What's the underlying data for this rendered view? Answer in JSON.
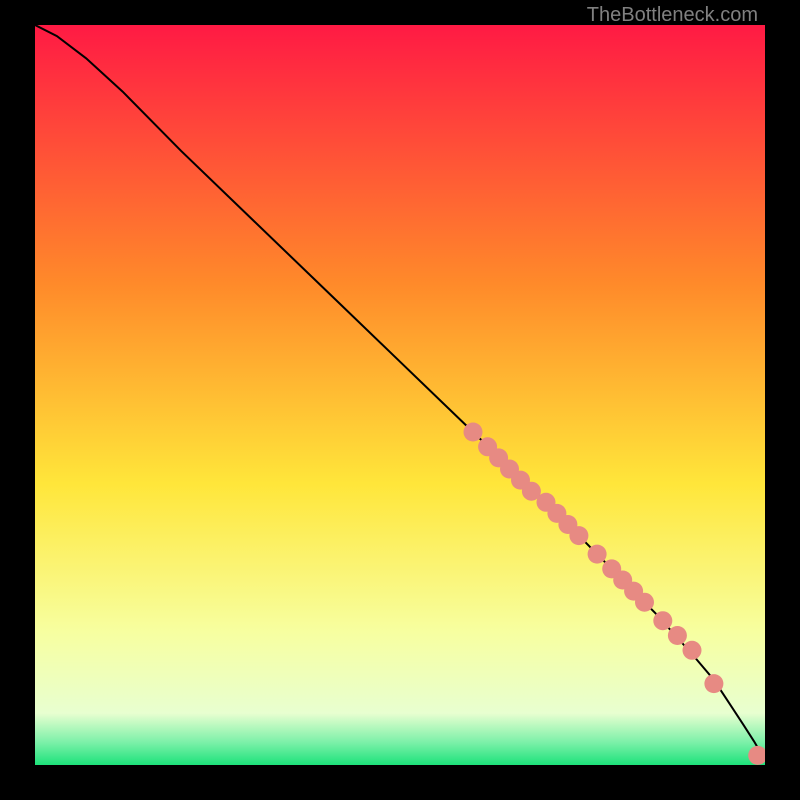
{
  "attribution": "TheBottleneck.com",
  "colors": {
    "frame": "#000000",
    "grad_top": "#ff1a44",
    "grad_mid1": "#ff8a2a",
    "grad_mid2": "#ffe63a",
    "grad_mid3": "#f7ffa0",
    "grad_bottom": "#1de27a",
    "curve": "#000000",
    "markers": "#e78a83"
  },
  "chart_data": {
    "type": "line",
    "title": "",
    "xlabel": "",
    "ylabel": "",
    "xlim": [
      0,
      100
    ],
    "ylim": [
      0,
      100
    ],
    "curve": {
      "x": [
        0,
        3,
        7,
        12,
        20,
        30,
        40,
        50,
        60,
        70,
        80,
        85,
        90,
        93,
        95,
        97,
        98.5,
        99.5,
        100
      ],
      "y": [
        100,
        98.5,
        95.5,
        91,
        83,
        73.5,
        64,
        54.5,
        45,
        35.5,
        25.5,
        20.5,
        15,
        11.5,
        8.5,
        5.5,
        3.2,
        1.5,
        1.2
      ]
    },
    "series": [
      {
        "name": "markers",
        "x": [
          60,
          62,
          63.5,
          65,
          66.5,
          68,
          70,
          71.5,
          73,
          74.5,
          77,
          79,
          80.5,
          82,
          83.5,
          86,
          88,
          90,
          93,
          99,
          101
        ],
        "y": [
          45,
          43,
          41.5,
          40,
          38.5,
          37,
          35.5,
          34,
          32.5,
          31,
          28.5,
          26.5,
          25,
          23.5,
          22,
          19.5,
          17.5,
          15.5,
          11,
          1.3,
          1.3
        ]
      }
    ]
  }
}
